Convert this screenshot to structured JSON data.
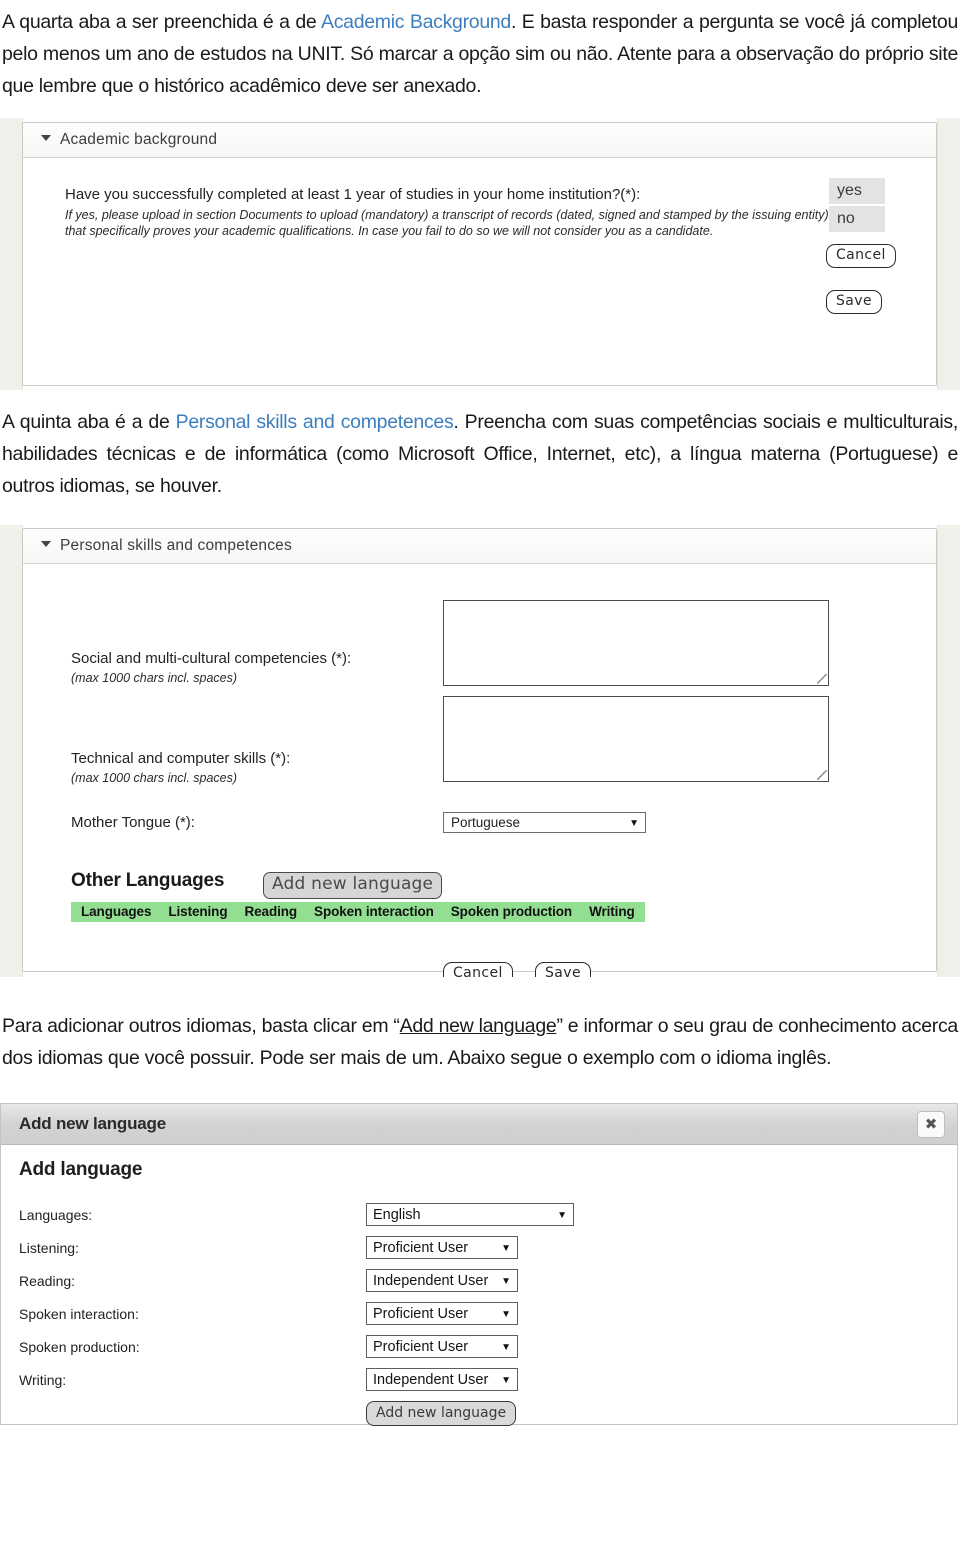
{
  "paragraphs": {
    "p1": {
      "before": "A quarta aba a ser preenchida é a de ",
      "link": "Academic Background",
      "after": ". E basta responder a pergunta se você já completou pelo menos um ano de estudos na UNIT. Só marcar a opção sim ou não. Atente para a observação do próprio site que lembre que o histórico acadêmico deve ser anexado."
    },
    "p2": {
      "before": "A quinta aba é a de ",
      "link": "Personal skills and competences",
      "after": ". Preencha com suas competências sociais e multiculturais, habilidades técnicas e de informática (como Microsoft Office, Internet, etc), a língua materna (Portuguese) e outros idiomas, se houver."
    },
    "p3": {
      "before": "Para adicionar outros idiomas, basta clicar em “",
      "underlined": "Add new language",
      "after": "” e informar o seu grau de conhecimento acerca dos idiomas que você possuir. Pode ser mais de um. Abaixo segue o exemplo com o idioma inglês."
    }
  },
  "academic_background": {
    "panel_title": "Academic background",
    "question": "Have you successfully completed at least 1 year of studies in your home institution?(*):",
    "note": "If yes, please upload in section Documents to upload (mandatory) a transcript of records (dated, signed and stamped by the issuing entity) that specifically proves your academic qualifications. In case you fail to do so we will not consider you as a candidate.",
    "options": [
      "yes",
      "no"
    ],
    "cancel_label": "Cancel",
    "save_label": "Save"
  },
  "personal_skills": {
    "panel_title": "Personal skills and competences",
    "social_label": "Social and multi-cultural competencies (*):",
    "social_hint": "(max 1000 chars incl. spaces)",
    "social_value": "",
    "technical_label": "Technical and computer skills (*):",
    "technical_hint": "(max 1000 chars incl. spaces)",
    "technical_value": "",
    "mother_tongue_label": "Mother Tongue (*):",
    "mother_tongue_value": "Portuguese",
    "other_languages_title": "Other Languages",
    "add_new_language_label": "Add new language",
    "table_headers": [
      "Languages",
      "Listening",
      "Reading",
      "Spoken interaction",
      "Spoken production",
      "Writing"
    ],
    "table_rows": [],
    "cancel_label": "Cancel",
    "save_label": "Save",
    "header_color": "#92df92"
  },
  "add_language_dialog": {
    "window_title": "Add new language",
    "close_icon": "✖",
    "heading": "Add language",
    "fields": [
      {
        "label": "Languages:",
        "value": "English"
      },
      {
        "label": "Listening:",
        "value": "Proficient User"
      },
      {
        "label": "Reading:",
        "value": "Independent User"
      },
      {
        "label": "Spoken interaction:",
        "value": "Proficient User"
      },
      {
        "label": "Spoken production:",
        "value": "Proficient User"
      },
      {
        "label": "Writing:",
        "value": "Independent User"
      }
    ],
    "submit_label": "Add new language"
  },
  "icons": {
    "caret_down": "caret-down-icon",
    "select_arrow": "▼"
  }
}
